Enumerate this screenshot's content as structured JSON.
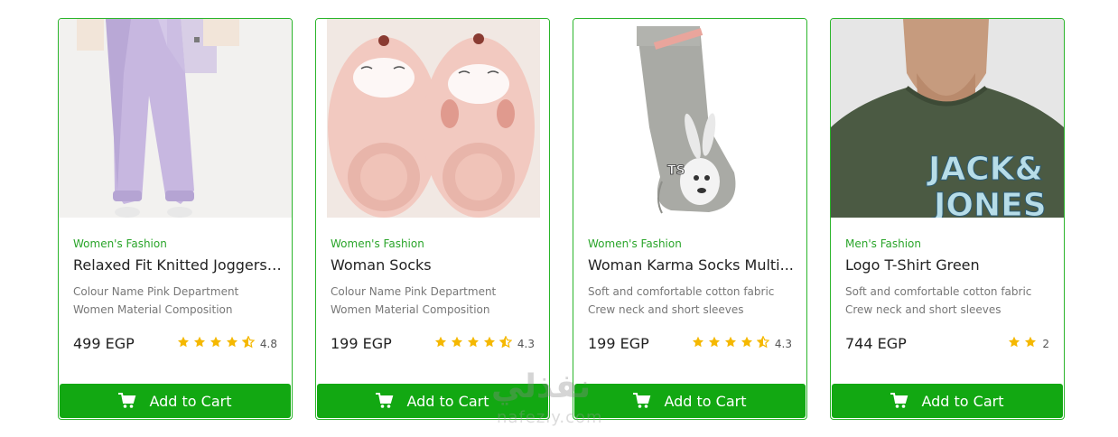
{
  "products": [
    {
      "category": "Women's Fashion",
      "title": "Relaxed Fit Knitted Joggers ...",
      "desc_line1": "Colour Name Pink Department",
      "desc_line2": "Women Material Composition",
      "price": "499 EGP",
      "rating": "4.8",
      "stars": 4.5,
      "cart_label": "Add to Cart",
      "image_icon": "lavender-joggers-photo"
    },
    {
      "category": "Women's Fashion",
      "title": "Woman Socks",
      "desc_line1": "Colour Name Pink Department",
      "desc_line2": "Women Material Composition",
      "price": "199 EGP",
      "rating": "4.3",
      "stars": 4.5,
      "cart_label": "Add to Cart",
      "image_icon": "pink-fuzzy-socks-photo"
    },
    {
      "category": "Women's Fashion",
      "title": "Woman Karma Socks Multi...",
      "desc_line1": "Soft and comfortable cotton fabric",
      "desc_line2": "Crew neck and short sleeves",
      "price": "199 EGP",
      "rating": "4.3",
      "stars": 4.5,
      "cart_label": "Add to Cart",
      "image_icon": "grey-bunny-sock-photo"
    },
    {
      "category": "Men's Fashion",
      "title": "Logo T-Shirt Green",
      "desc_line1": "Soft and comfortable cotton fabric",
      "desc_line2": "Crew neck and short sleeves",
      "price": "744 EGP",
      "rating": "2",
      "stars": 2,
      "cart_label": "Add to Cart",
      "image_icon": "green-tshirt-photo",
      "image_text_1": "JACK&",
      "image_text_2": "JONES"
    }
  ],
  "watermark": {
    "arabic": "نفذلي",
    "latin": "nafezly.com"
  },
  "colors": {
    "accent": "#12a812",
    "border": "#2bb52b",
    "category": "#2aa52a",
    "star": "#f5b800"
  }
}
